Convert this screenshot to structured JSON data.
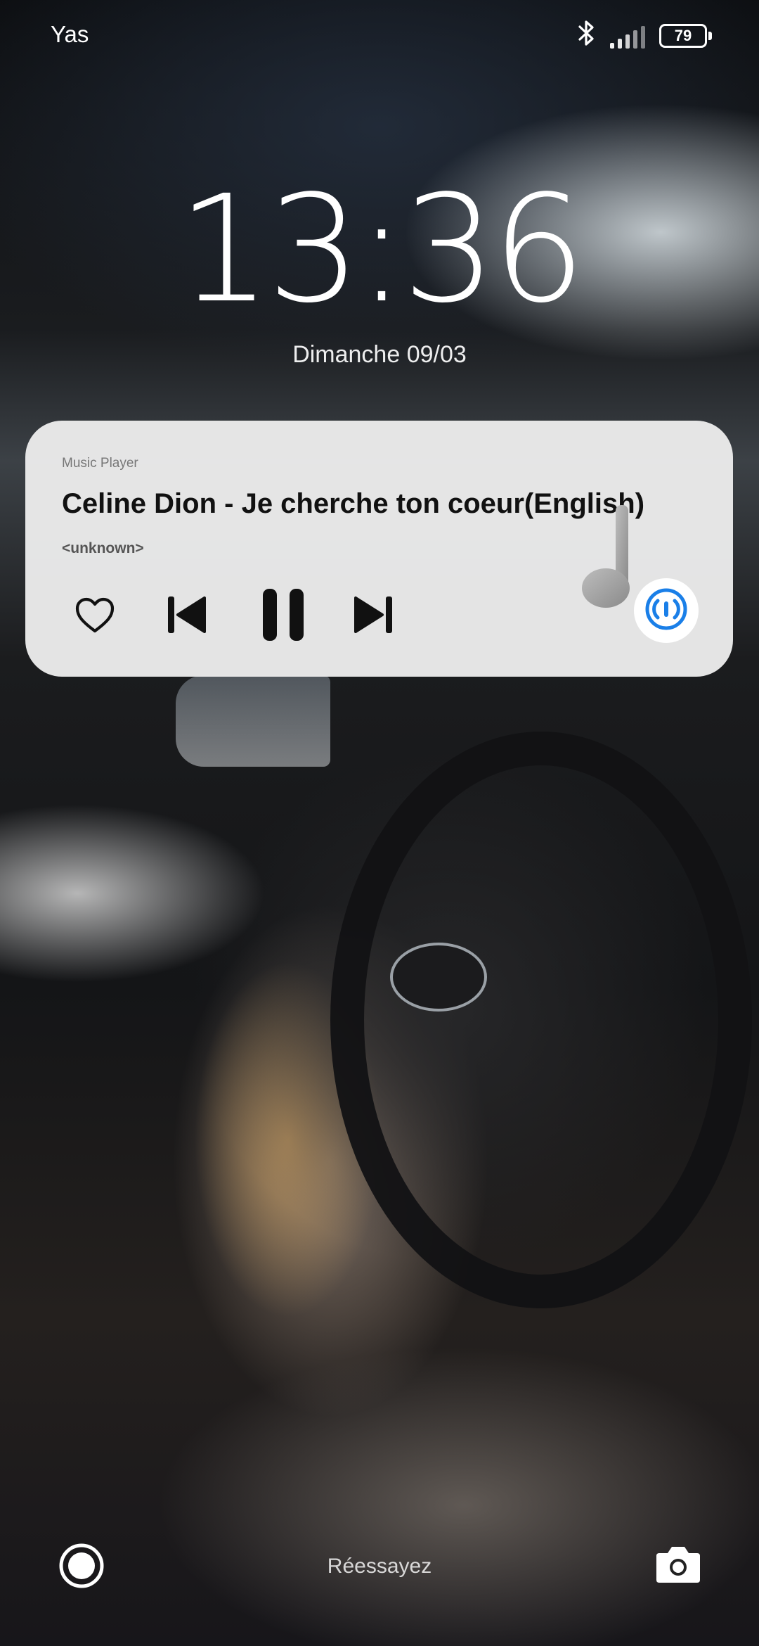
{
  "status_bar": {
    "carrier": "Yas",
    "battery_level": "79",
    "bluetooth_icon": "bluetooth-icon",
    "signal_icon": "signal-strength-icon"
  },
  "lockscreen": {
    "time": "13:36",
    "date": "Dimanche 09/03"
  },
  "music_widget": {
    "app_name": "Music Player",
    "track_title": "Celine Dion - Je cherche ton coeur(English)",
    "artist": "<unknown>",
    "icons": {
      "favorite": "heart-icon",
      "previous": "previous-track-icon",
      "pause": "pause-icon",
      "next": "next-track-icon",
      "output": "audio-output-icon",
      "artwork": "music-note-icon"
    },
    "accent_color": "#1a7fe8"
  },
  "bottom_bar": {
    "retry_text": "Réessayez",
    "left_icon": "circle-target-icon",
    "right_icon": "camera-icon"
  }
}
